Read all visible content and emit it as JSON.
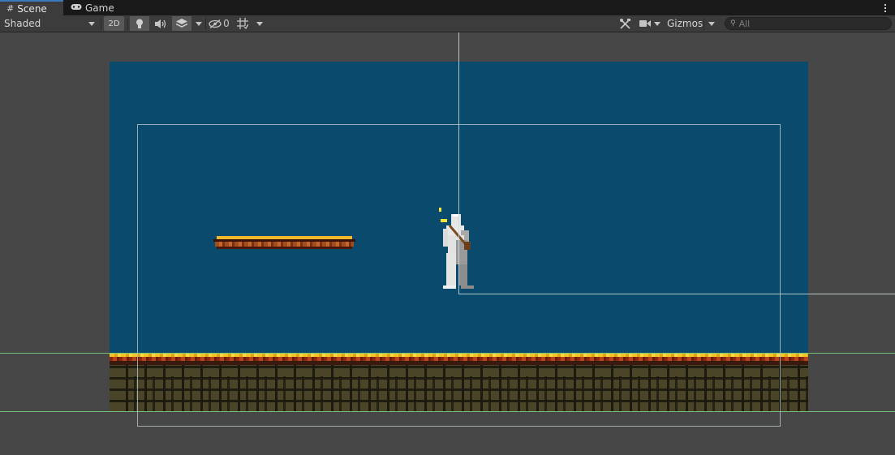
{
  "tabs": [
    {
      "label": "Scene",
      "icon": "hash-grid-icon",
      "active": true
    },
    {
      "label": "Game",
      "icon": "gamepad-icon",
      "active": false
    }
  ],
  "toolbar": {
    "shading_mode": "Shaded",
    "mode_2d_label": "2D",
    "hidden_count": "0",
    "gizmos_label": "Gizmos"
  },
  "search": {
    "placeholder": "All"
  },
  "colors": {
    "tab_accent": "#3a79bb",
    "camera_background": "#0a4a6c",
    "ground_gold": "#f3c425",
    "ground_stone": "#4a4528",
    "boundary_line": "#7ec87e"
  }
}
